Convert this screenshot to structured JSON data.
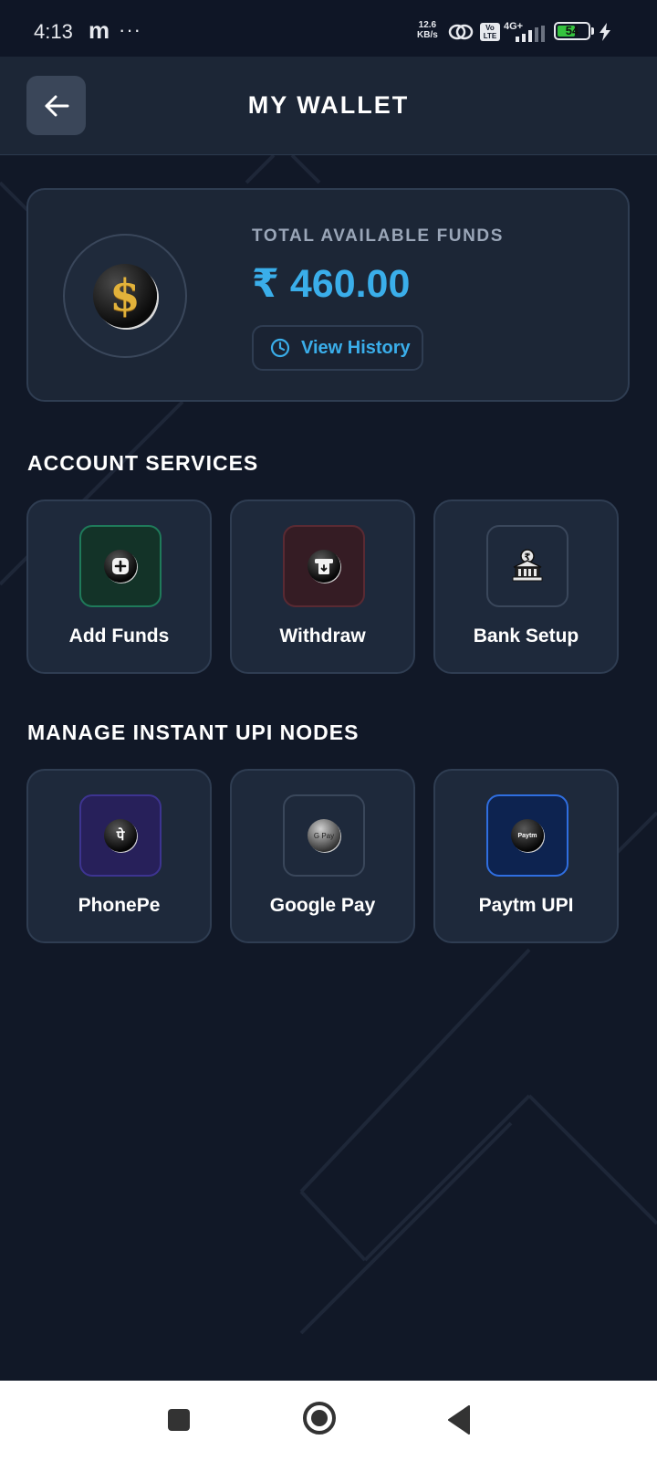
{
  "status_bar": {
    "time": "4:13",
    "app_letter": "m",
    "more": "···",
    "net_speed_value": "12.6",
    "net_speed_unit": "KB/s",
    "volte": "Vo LTE",
    "network": "4G+",
    "battery_level": "54"
  },
  "header": {
    "title": "MY WALLET",
    "back_icon": "arrow-left-icon"
  },
  "balance": {
    "label": "TOTAL AVAILABLE FUNDS",
    "amount": "₹ 460.00",
    "history_button": "View History",
    "coin_icon": "dollar-coin-icon",
    "history_icon": "clock-icon"
  },
  "account_services": {
    "title": "ACCOUNT SERVICES",
    "items": [
      {
        "label": "Add Funds",
        "icon": "plus-icon",
        "tint": "#133328",
        "border": "#1f7a5a"
      },
      {
        "label": "Withdraw",
        "icon": "atm-withdraw-icon",
        "tint": "#351c24",
        "border": "#5a2a33"
      },
      {
        "label": "Bank Setup",
        "icon": "bank-icon",
        "tint": "#1e293b",
        "border": "#3a475b"
      }
    ]
  },
  "upi_nodes": {
    "title": "MANAGE INSTANT UPI NODES",
    "items": [
      {
        "label": "PhonePe",
        "icon": "phonepe-icon",
        "glyph": "पे",
        "tint": "#27205a",
        "border": "#3d3490"
      },
      {
        "label": "Google Pay",
        "icon": "google-pay-icon",
        "glyph": "G Pay",
        "tint": "#1e293b",
        "border": "#3a475b"
      },
      {
        "label": "Paytm UPI",
        "icon": "paytm-icon",
        "glyph": "Paytm",
        "tint": "#0d2350",
        "border": "#2f6ee0"
      }
    ]
  },
  "nav_bar": {
    "recents": "square-icon",
    "home": "circle-icon",
    "back": "triangle-back-icon"
  },
  "colors": {
    "accent": "#3aaeea",
    "background": "#111827",
    "card": "#1e293b"
  }
}
